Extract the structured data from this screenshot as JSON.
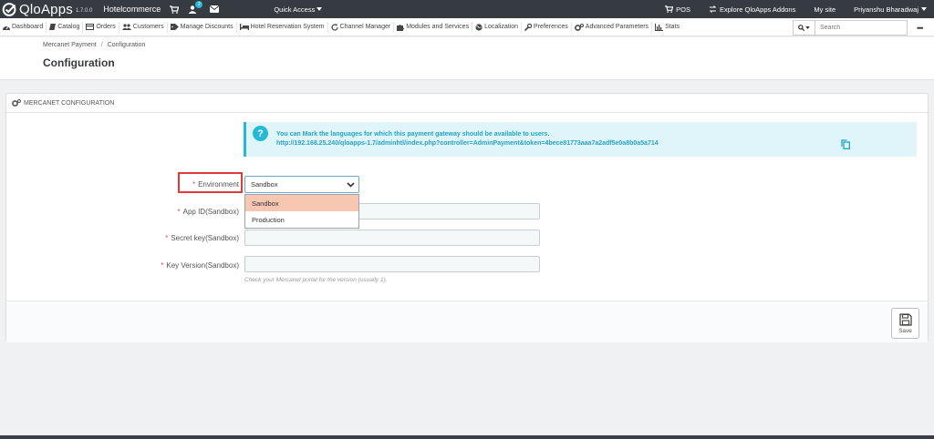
{
  "app": {
    "logo_text": "QloApps",
    "version": "1.7.0.0",
    "shop_name": "Hotelcommerce",
    "notification_count": "2",
    "quick_access": "Quick Access",
    "pos": "POS",
    "explore_addons": "Explore QloApps Addons",
    "my_site": "My site",
    "user_name": "Priyanshu Bharadwaj"
  },
  "nav": {
    "items": [
      {
        "label": "Dashboard",
        "icon": "dashboard-icon"
      },
      {
        "label": "Catalog",
        "icon": "book-icon"
      },
      {
        "label": "Orders",
        "icon": "credit-card-icon"
      },
      {
        "label": "Customers",
        "icon": "users-icon"
      },
      {
        "label": "Manage Discounts",
        "icon": "tag-icon"
      },
      {
        "label": "Hotel Reservation System",
        "icon": "bed-icon"
      },
      {
        "label": "Channel Manager",
        "icon": "refresh-icon"
      },
      {
        "label": "Modules and Services",
        "icon": "puzzle-icon"
      },
      {
        "label": "Localization",
        "icon": "globe-icon"
      },
      {
        "label": "Preferences",
        "icon": "wrench-icon"
      },
      {
        "label": "Advanced Parameters",
        "icon": "cogs-icon"
      },
      {
        "label": "Stats",
        "icon": "bar-chart-icon"
      }
    ],
    "search_placeholder": "Search"
  },
  "header": {
    "breadcrumb_parent": "Mercanet Payment",
    "breadcrumb_separator": "/",
    "breadcrumb_current": "Configuration",
    "title": "Configuration"
  },
  "panel": {
    "heading": "MERCANET CONFIGURATION",
    "alert_line1": "You can Mark the languages for which this payment gateway should be available to users.",
    "alert_line2": "http://192.168.25.240/qloapps-1.7/adminhtl/index.php?controller=AdminPayment&token=4bece81773aaa7a2adf5e0a8b0a5a714",
    "fields": {
      "environment_label": "Environment",
      "environment_value": "Sandbox",
      "environment_options": [
        "Sandbox",
        "Production"
      ],
      "app_id_label": "App ID(Sandbox)",
      "secret_key_label": "Secret key(Sandbox)",
      "key_version_label": "Key Version(Sandbox)",
      "key_version_help": "Check your Mercanet portal for the version (usually 1).",
      "required_mark": "*"
    },
    "save_label": "Save"
  },
  "colors": {
    "topbar": "#363a41",
    "accent": "#25b9d7",
    "required": "#e05151",
    "highlight_box": "#e03a3a",
    "dropdown_selected": "#f8c7b2"
  }
}
